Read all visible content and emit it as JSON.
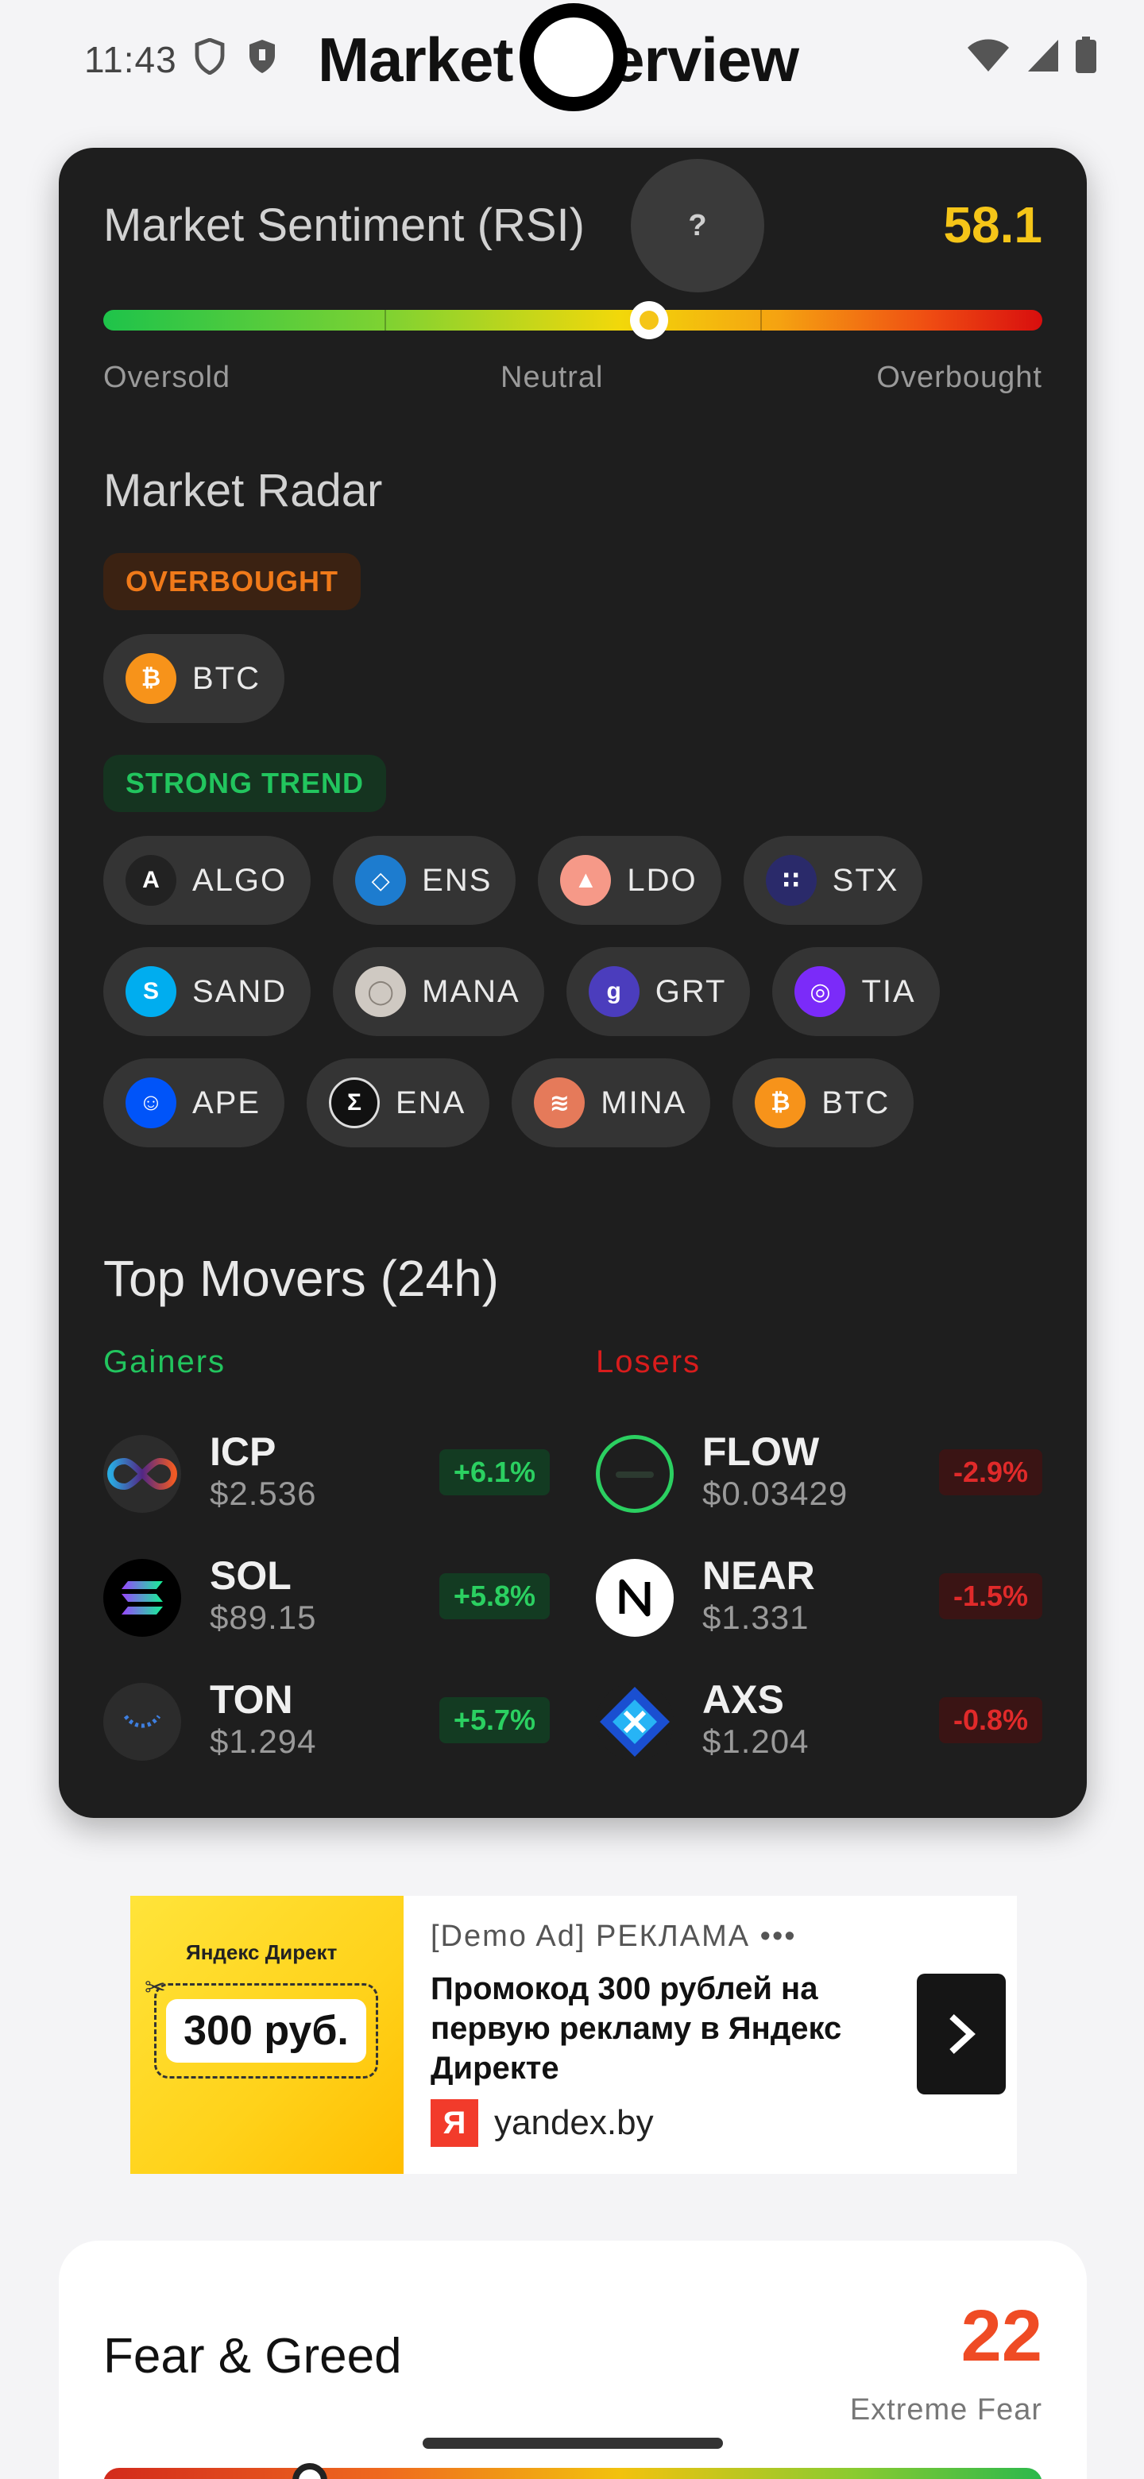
{
  "status_bar": {
    "time": "11:43"
  },
  "page": {
    "title": "Market Overview"
  },
  "rsi": {
    "title": "Market Sentiment (RSI)",
    "help_label": "?",
    "value": "58.1",
    "value_numeric": 58.1,
    "labels": {
      "low": "Oversold",
      "mid": "Neutral",
      "high": "Overbought"
    },
    "colors": {
      "value": "#f5c518"
    }
  },
  "radar": {
    "title": "Market Radar",
    "overbought": {
      "label": "OVERBOUGHT",
      "coins": [
        {
          "symbol": "BTC",
          "icon": "bitcoin-icon",
          "color": "#f7931a"
        }
      ]
    },
    "strong_trend": {
      "label": "STRONG TREND",
      "rows": [
        [
          {
            "symbol": "ALGO",
            "icon": "algorand-icon",
            "color": "#222222"
          },
          {
            "symbol": "ENS",
            "icon": "ens-icon",
            "color": "#1d7ccf"
          },
          {
            "symbol": "LDO",
            "icon": "lido-icon",
            "color": "#f69988"
          },
          {
            "symbol": "STX",
            "icon": "stacks-icon",
            "color": "#2a2a6a"
          }
        ],
        [
          {
            "symbol": "SAND",
            "icon": "sandbox-icon",
            "color": "#00adef"
          },
          {
            "symbol": "MANA",
            "icon": "decentraland-icon",
            "color": "#cfc9c2"
          },
          {
            "symbol": "GRT",
            "icon": "graph-icon",
            "color": "#4b3dbd"
          },
          {
            "symbol": "TIA",
            "icon": "celestia-icon",
            "color": "#7b2bf9"
          }
        ],
        [
          {
            "symbol": "APE",
            "icon": "apecoin-icon",
            "color": "#0054f9"
          },
          {
            "symbol": "ENA",
            "icon": "ethena-icon",
            "color": "#111111"
          },
          {
            "symbol": "MINA",
            "icon": "mina-icon",
            "color": "#e57a5a"
          },
          {
            "symbol": "BTC",
            "icon": "bitcoin-icon",
            "color": "#f7931a"
          }
        ]
      ]
    }
  },
  "movers": {
    "title": "Top Movers (24h)",
    "gainers_label": "Gainers",
    "losers_label": "Losers",
    "colors": {
      "gainers": "#22c55e",
      "losers": "#d91c1c"
    },
    "gainers": [
      {
        "symbol": "ICP",
        "price": "$2.536",
        "change": "+6.1%",
        "icon": "internet-computer-icon"
      },
      {
        "symbol": "SOL",
        "price": "$89.15",
        "change": "+5.8%",
        "icon": "solana-icon"
      },
      {
        "symbol": "TON",
        "price": "$1.294",
        "change": "+5.7%",
        "icon": "toncoin-icon"
      }
    ],
    "losers": [
      {
        "symbol": "FLOW",
        "price": "$0.03429",
        "change": "-2.9%",
        "icon": "flow-icon"
      },
      {
        "symbol": "NEAR",
        "price": "$1.331",
        "change": "-1.5%",
        "icon": "near-icon"
      },
      {
        "symbol": "AXS",
        "price": "$1.204",
        "change": "-0.8%",
        "icon": "axie-icon"
      }
    ]
  },
  "ad": {
    "label": "[Demo Ad] РЕКЛАМА •••",
    "brand": "Яндекс Директ",
    "coupon": "300 руб.",
    "headline": "Промокод 300 рублей на первую рекламу в Яндекс Директе",
    "logo_letter": "Я",
    "domain": "yandex.by"
  },
  "fear_greed": {
    "title": "Fear & Greed",
    "value": "22",
    "value_numeric": 22,
    "label": "Extreme Fear",
    "colors": {
      "value": "#ef4b24"
    }
  }
}
